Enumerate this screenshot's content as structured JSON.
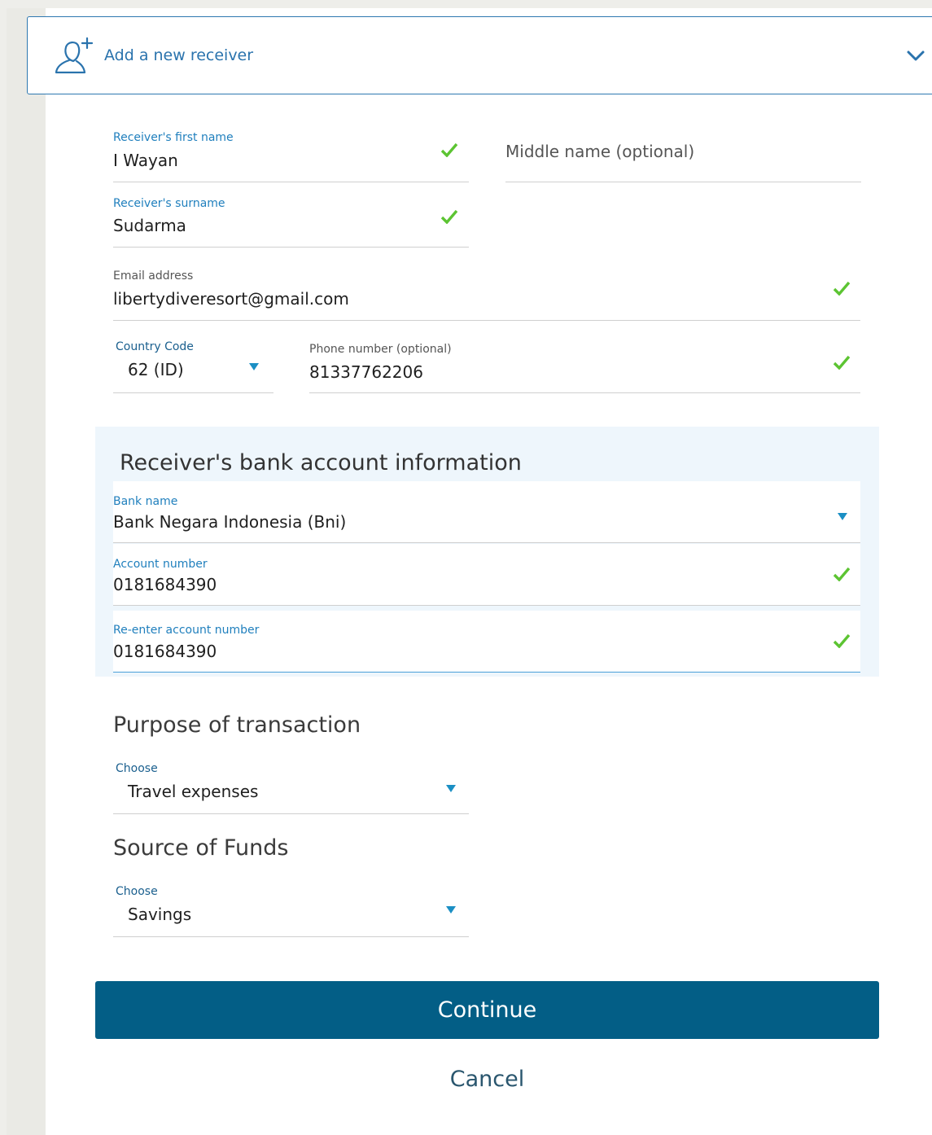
{
  "header": {
    "title": "Add a new receiver",
    "icon": "add-person-icon",
    "chevron": "chevron-down-icon"
  },
  "receiver": {
    "first_name": {
      "label": "Receiver's first name",
      "value": "I Wayan",
      "valid": true
    },
    "middle_name": {
      "placeholder": "Middle name (optional)"
    },
    "surname": {
      "label": "Receiver's surname",
      "value": "Sudarma",
      "valid": true
    },
    "email": {
      "label": "Email address",
      "value": "libertydiveresort@gmail.com",
      "valid": true
    },
    "country_code": {
      "label": "Country Code",
      "value": "62 (ID)"
    },
    "phone": {
      "label": "Phone number (optional)",
      "value": "81337762206",
      "valid": true
    }
  },
  "bank": {
    "title": "Receiver's bank account information",
    "bank_name": {
      "label": "Bank name",
      "value": "Bank Negara Indonesia (Bni)"
    },
    "account_number": {
      "label": "Account number",
      "value": "0181684390",
      "valid": true
    },
    "reenter_account_number": {
      "label": "Re-enter account number",
      "value": "0181684390",
      "valid": true
    }
  },
  "purpose": {
    "title": "Purpose of transaction",
    "label": "Choose",
    "value": "Travel expenses"
  },
  "source": {
    "title": "Source of Funds",
    "label": "Choose",
    "value": "Savings"
  },
  "actions": {
    "continue": "Continue",
    "cancel": "Cancel"
  },
  "colors": {
    "accent": "#1f7fbd",
    "primary_button": "#035e86",
    "check": "#5cc432",
    "bank_bg": "#eef6fc"
  }
}
